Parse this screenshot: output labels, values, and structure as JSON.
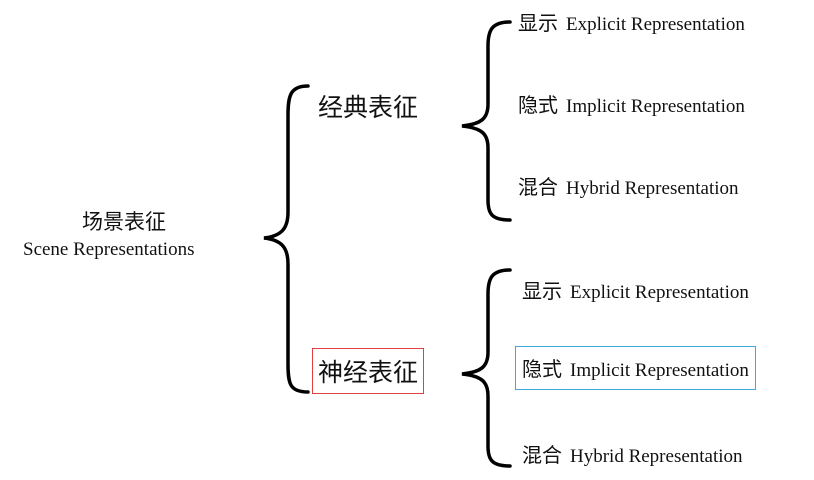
{
  "root": {
    "zh": "场景表征",
    "en": "Scene Representations"
  },
  "branches": [
    {
      "label": "经典表征",
      "highlighted": false,
      "children": [
        {
          "zh": "显示",
          "en": "Explicit Representation",
          "highlighted": false
        },
        {
          "zh": "隐式",
          "en": "Implicit Representation",
          "highlighted": false
        },
        {
          "zh": "混合",
          "en": "Hybrid Representation",
          "highlighted": false
        }
      ]
    },
    {
      "label": "神经表征",
      "highlighted": true,
      "highlight_color": "#e04040",
      "children": [
        {
          "zh": "显示",
          "en": "Explicit Representation",
          "highlighted": false
        },
        {
          "zh": "隐式",
          "en": "Implicit Representation",
          "highlighted": true,
          "highlight_color": "#3aa8d8"
        },
        {
          "zh": "混合",
          "en": "Hybrid Representation",
          "highlighted": false
        }
      ]
    }
  ]
}
